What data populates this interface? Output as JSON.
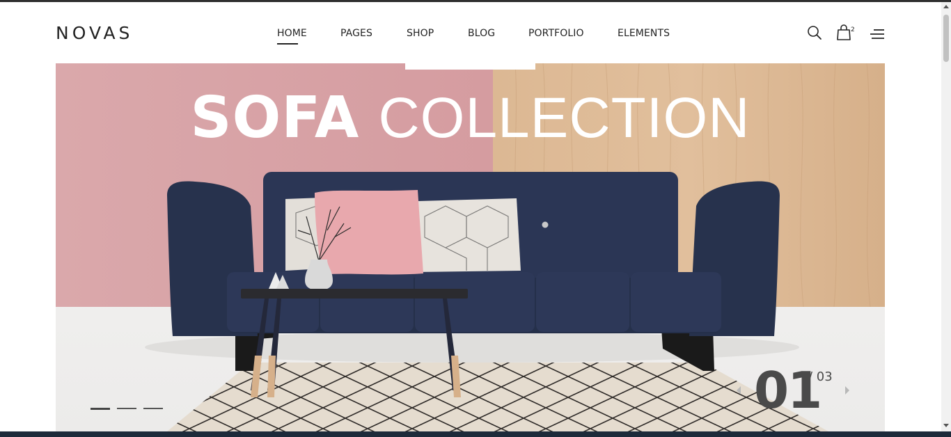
{
  "header": {
    "logo": "NOVAS",
    "nav": [
      {
        "label": "HOME",
        "active": true
      },
      {
        "label": "PAGES",
        "active": false
      },
      {
        "label": "SHOP",
        "active": false
      },
      {
        "label": "BLOG",
        "active": false
      },
      {
        "label": "PORTFOLIO",
        "active": false
      },
      {
        "label": "ELEMENTS",
        "active": false
      }
    ],
    "icons": {
      "search": "search-icon",
      "cart": "shopping-bag-icon",
      "menu": "hamburger-menu-icon"
    },
    "cart_count": "2"
  },
  "hero": {
    "title_bold": "SOFA",
    "title_light": "COLLECTION",
    "slide_current": "01",
    "slide_total": "/ 03",
    "slides": [
      {
        "label": "slide-1",
        "active": true
      },
      {
        "label": "slide-2",
        "active": false
      },
      {
        "label": "slide-3",
        "active": false
      }
    ],
    "colors": {
      "pink_wall": "#d9a1a6",
      "wood_wall": "#d9b48e",
      "sofa": "#27324d"
    }
  }
}
